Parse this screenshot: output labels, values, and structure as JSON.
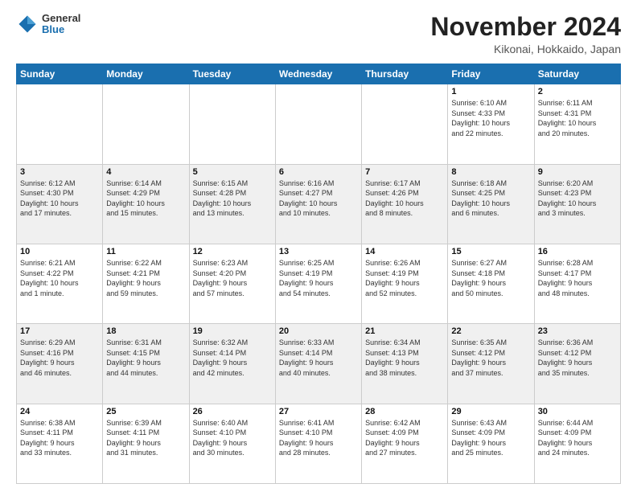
{
  "logo": {
    "general": "General",
    "blue": "Blue"
  },
  "title": "November 2024",
  "location": "Kikonai, Hokkaido, Japan",
  "days_of_week": [
    "Sunday",
    "Monday",
    "Tuesday",
    "Wednesday",
    "Thursday",
    "Friday",
    "Saturday"
  ],
  "weeks": [
    [
      {
        "day": "",
        "info": ""
      },
      {
        "day": "",
        "info": ""
      },
      {
        "day": "",
        "info": ""
      },
      {
        "day": "",
        "info": ""
      },
      {
        "day": "",
        "info": ""
      },
      {
        "day": "1",
        "info": "Sunrise: 6:10 AM\nSunset: 4:33 PM\nDaylight: 10 hours\nand 22 minutes."
      },
      {
        "day": "2",
        "info": "Sunrise: 6:11 AM\nSunset: 4:31 PM\nDaylight: 10 hours\nand 20 minutes."
      }
    ],
    [
      {
        "day": "3",
        "info": "Sunrise: 6:12 AM\nSunset: 4:30 PM\nDaylight: 10 hours\nand 17 minutes."
      },
      {
        "day": "4",
        "info": "Sunrise: 6:14 AM\nSunset: 4:29 PM\nDaylight: 10 hours\nand 15 minutes."
      },
      {
        "day": "5",
        "info": "Sunrise: 6:15 AM\nSunset: 4:28 PM\nDaylight: 10 hours\nand 13 minutes."
      },
      {
        "day": "6",
        "info": "Sunrise: 6:16 AM\nSunset: 4:27 PM\nDaylight: 10 hours\nand 10 minutes."
      },
      {
        "day": "7",
        "info": "Sunrise: 6:17 AM\nSunset: 4:26 PM\nDaylight: 10 hours\nand 8 minutes."
      },
      {
        "day": "8",
        "info": "Sunrise: 6:18 AM\nSunset: 4:25 PM\nDaylight: 10 hours\nand 6 minutes."
      },
      {
        "day": "9",
        "info": "Sunrise: 6:20 AM\nSunset: 4:23 PM\nDaylight: 10 hours\nand 3 minutes."
      }
    ],
    [
      {
        "day": "10",
        "info": "Sunrise: 6:21 AM\nSunset: 4:22 PM\nDaylight: 10 hours\nand 1 minute."
      },
      {
        "day": "11",
        "info": "Sunrise: 6:22 AM\nSunset: 4:21 PM\nDaylight: 9 hours\nand 59 minutes."
      },
      {
        "day": "12",
        "info": "Sunrise: 6:23 AM\nSunset: 4:20 PM\nDaylight: 9 hours\nand 57 minutes."
      },
      {
        "day": "13",
        "info": "Sunrise: 6:25 AM\nSunset: 4:19 PM\nDaylight: 9 hours\nand 54 minutes."
      },
      {
        "day": "14",
        "info": "Sunrise: 6:26 AM\nSunset: 4:19 PM\nDaylight: 9 hours\nand 52 minutes."
      },
      {
        "day": "15",
        "info": "Sunrise: 6:27 AM\nSunset: 4:18 PM\nDaylight: 9 hours\nand 50 minutes."
      },
      {
        "day": "16",
        "info": "Sunrise: 6:28 AM\nSunset: 4:17 PM\nDaylight: 9 hours\nand 48 minutes."
      }
    ],
    [
      {
        "day": "17",
        "info": "Sunrise: 6:29 AM\nSunset: 4:16 PM\nDaylight: 9 hours\nand 46 minutes."
      },
      {
        "day": "18",
        "info": "Sunrise: 6:31 AM\nSunset: 4:15 PM\nDaylight: 9 hours\nand 44 minutes."
      },
      {
        "day": "19",
        "info": "Sunrise: 6:32 AM\nSunset: 4:14 PM\nDaylight: 9 hours\nand 42 minutes."
      },
      {
        "day": "20",
        "info": "Sunrise: 6:33 AM\nSunset: 4:14 PM\nDaylight: 9 hours\nand 40 minutes."
      },
      {
        "day": "21",
        "info": "Sunrise: 6:34 AM\nSunset: 4:13 PM\nDaylight: 9 hours\nand 38 minutes."
      },
      {
        "day": "22",
        "info": "Sunrise: 6:35 AM\nSunset: 4:12 PM\nDaylight: 9 hours\nand 37 minutes."
      },
      {
        "day": "23",
        "info": "Sunrise: 6:36 AM\nSunset: 4:12 PM\nDaylight: 9 hours\nand 35 minutes."
      }
    ],
    [
      {
        "day": "24",
        "info": "Sunrise: 6:38 AM\nSunset: 4:11 PM\nDaylight: 9 hours\nand 33 minutes."
      },
      {
        "day": "25",
        "info": "Sunrise: 6:39 AM\nSunset: 4:11 PM\nDaylight: 9 hours\nand 31 minutes."
      },
      {
        "day": "26",
        "info": "Sunrise: 6:40 AM\nSunset: 4:10 PM\nDaylight: 9 hours\nand 30 minutes."
      },
      {
        "day": "27",
        "info": "Sunrise: 6:41 AM\nSunset: 4:10 PM\nDaylight: 9 hours\nand 28 minutes."
      },
      {
        "day": "28",
        "info": "Sunrise: 6:42 AM\nSunset: 4:09 PM\nDaylight: 9 hours\nand 27 minutes."
      },
      {
        "day": "29",
        "info": "Sunrise: 6:43 AM\nSunset: 4:09 PM\nDaylight: 9 hours\nand 25 minutes."
      },
      {
        "day": "30",
        "info": "Sunrise: 6:44 AM\nSunset: 4:09 PM\nDaylight: 9 hours\nand 24 minutes."
      }
    ]
  ]
}
